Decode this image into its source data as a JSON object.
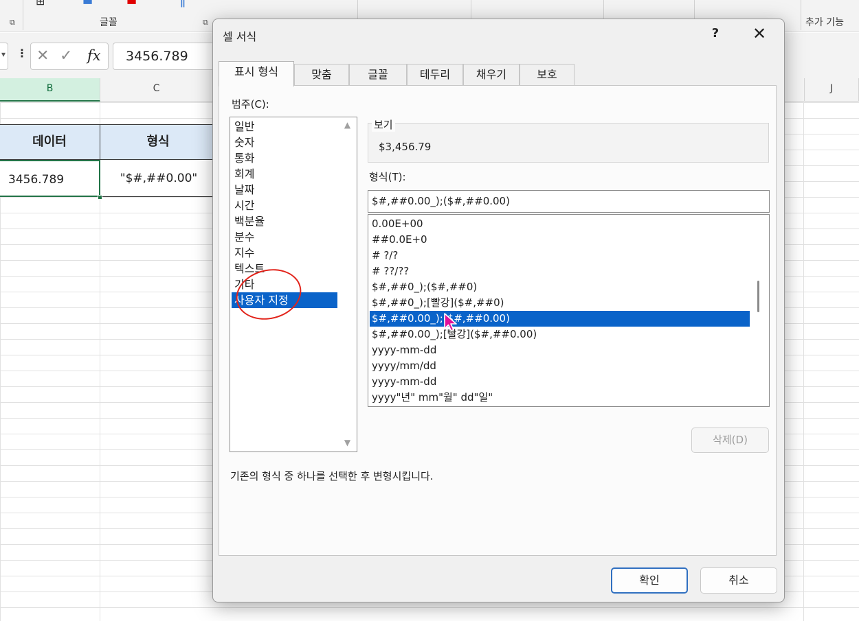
{
  "ribbon": {
    "groups": [
      "글꼴",
      "추가 기능"
    ]
  },
  "formula_bar": {
    "more": "⋮",
    "cancel_icon": "✕",
    "enter_icon": "✓",
    "fx": "fx",
    "value": "3456.789"
  },
  "sheet": {
    "columns": [
      "B",
      "C",
      "J"
    ],
    "header_row": [
      "데이터",
      "형식"
    ],
    "data_row": [
      "3456.789",
      "\"$#,##0.00\""
    ]
  },
  "dialog": {
    "title": "셀 서식",
    "help": "?",
    "close": "✕",
    "tabs": [
      "표시 형식",
      "맞춤",
      "글꼴",
      "테두리",
      "채우기",
      "보호"
    ],
    "active_tab": "표시 형식",
    "category_label": "범주(C):",
    "categories": [
      "일반",
      "숫자",
      "통화",
      "회계",
      "날짜",
      "시간",
      "백분율",
      "분수",
      "지수",
      "텍스트",
      "기타",
      "사용자 지정"
    ],
    "selected_category": "사용자 지정",
    "preview_label": "보기",
    "preview_value": "$3,456.79",
    "type_label": "형식(T):",
    "type_value": "$#,##0.00_);($#,##0.00)",
    "formats": [
      "0.00E+00",
      "##0.0E+0",
      "# ?/?",
      "# ??/??",
      "$#,##0_);($#,##0)",
      "$#,##0_);[빨강]($#,##0)",
      "$#,##0.00_);($#,##0.00)",
      "$#,##0.00_);[빨강]($#,##0.00)",
      "yyyy-mm-dd",
      "yyyy/mm/dd",
      "yyyy-mm-dd",
      "yyyy\"년\" mm\"월\" dd\"일\""
    ],
    "selected_format": "$#,##0.00_);($#,##0.00)",
    "delete_button": "삭제(D)",
    "hint": "기존의 형식 중 하나를 선택한 후 변형시킵니다.",
    "ok_button": "확인",
    "cancel_button": "취소"
  },
  "colors": {
    "selection": "#0a63c9",
    "sheet_header_fill": "#dce9f7",
    "active_cell_border": "#217346",
    "annotation_circle": "#e2231a",
    "cursor": "#e0119a"
  }
}
